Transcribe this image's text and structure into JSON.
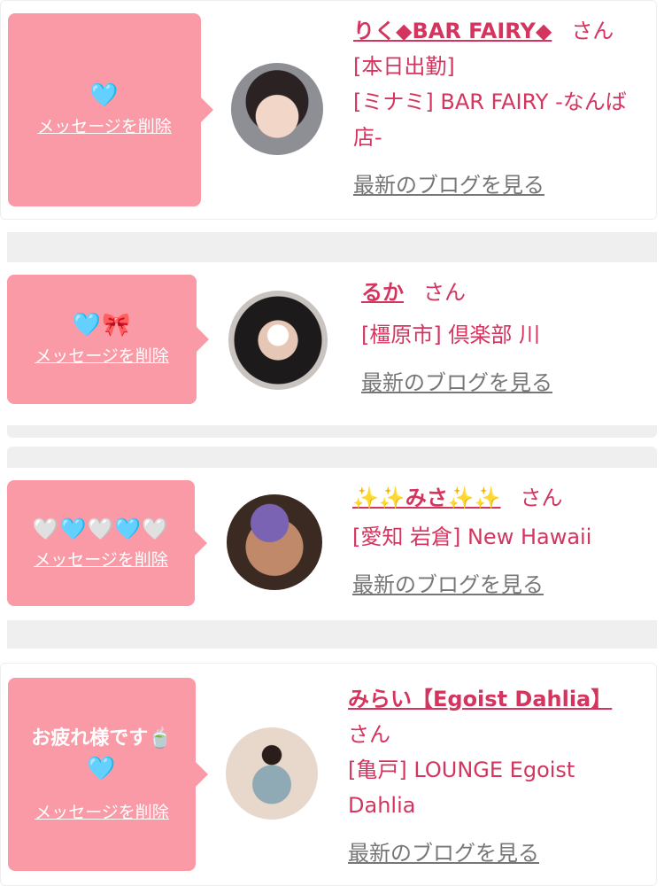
{
  "entries": [
    {
      "emoji": "🩵",
      "message": "",
      "delete_label": "メッセージを削除",
      "name": "りく◆BAR FAIRY◆",
      "honorific": "さん",
      "status": "[本日出勤]",
      "shop": "[ミナミ] BAR FAIRY -なんば店-",
      "blog_label": "最新のブログを見る",
      "avatar": "avatar-photo"
    },
    {
      "emoji": "🩵🎀",
      "message": "",
      "delete_label": "メッセージを削除",
      "name": "るか",
      "honorific": "さん",
      "status": "",
      "shop": "[橿原市] 倶楽部 川",
      "blog_label": "最新のブログを見る",
      "avatar": "avatar-photo"
    },
    {
      "emoji": "🤍🩵🤍🩵🤍",
      "message": "",
      "delete_label": "メッセージを削除",
      "name": "✨✨みさ✨✨",
      "honorific": "さん",
      "status": "",
      "shop": "[愛知 岩倉] New Hawaii",
      "blog_label": "最新のブログを見る",
      "avatar": "avatar-photo"
    },
    {
      "emoji": "🩵",
      "message": "お疲れ様です🍵",
      "delete_label": "メッセージを削除",
      "name": "みらい【Egoist Dahlia】",
      "honorific": "さん",
      "status": "",
      "shop": "[亀戸] LOUNGE Egoist Dahlia",
      "blog_label": "最新のブログを見る",
      "avatar": "avatar-photo"
    }
  ],
  "colors": {
    "bubble": "#f99aa6",
    "accent": "#d4355f",
    "link_gray": "#777777"
  }
}
